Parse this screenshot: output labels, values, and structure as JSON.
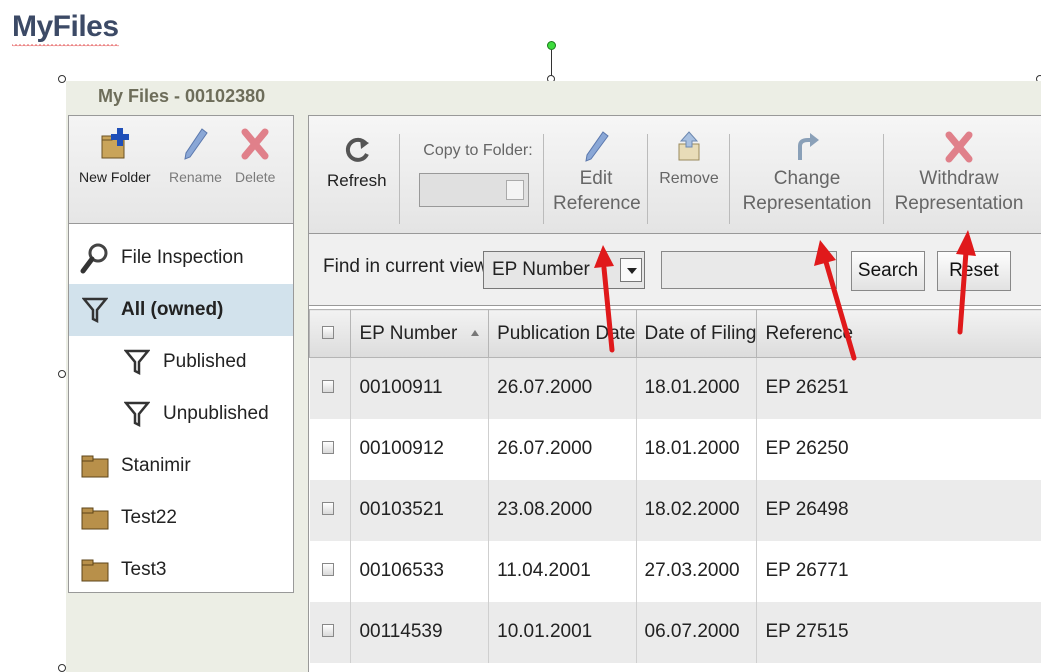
{
  "heading": "MyFiles",
  "window": {
    "title": "My Files - 00102380"
  },
  "left_toolbar": {
    "new_folder": "New Folder",
    "rename": "Rename",
    "delete": "Delete"
  },
  "tree": [
    {
      "label": "File Inspection",
      "icon": "magnifier-icon"
    },
    {
      "label": "All (owned)",
      "icon": "filter-icon",
      "selected": true
    },
    {
      "label": "Published",
      "icon": "filter-icon"
    },
    {
      "label": "Unpublished",
      "icon": "filter-icon"
    },
    {
      "label": "Stanimir",
      "icon": "folder-icon"
    },
    {
      "label": "Test22",
      "icon": "folder-icon"
    },
    {
      "label": "Test3",
      "icon": "folder-icon"
    }
  ],
  "toolbar": {
    "refresh": "Refresh",
    "copy_to_folder": "Copy to Folder:",
    "edit_line1": "Edit",
    "edit_line2": "Reference",
    "remove": "Remove",
    "change_line1": "Change",
    "change_line2": "Representation",
    "withdraw_line1": "Withdraw",
    "withdraw_line2": "Representation"
  },
  "search": {
    "find_label": "Find in current view",
    "field_selected": "EP Number",
    "query": "",
    "search_button": "Search",
    "reset_button": "Reset"
  },
  "table": {
    "columns": [
      "EP Number",
      "Publication Date",
      "Date of Filing",
      "Reference"
    ],
    "rows": [
      {
        "ep": "00100911",
        "pub": "26.07.2000",
        "filing": "18.01.2000",
        "ref": "EP 26251"
      },
      {
        "ep": "00100912",
        "pub": "26.07.2000",
        "filing": "18.01.2000",
        "ref": "EP 26250"
      },
      {
        "ep": "00103521",
        "pub": "23.08.2000",
        "filing": "18.02.2000",
        "ref": "EP 26498"
      },
      {
        "ep": "00106533",
        "pub": "11.04.2001",
        "filing": "27.03.2000",
        "ref": "EP 26771"
      },
      {
        "ep": "00114539",
        "pub": "10.01.2001",
        "filing": "06.07.2000",
        "ref": "EP 27515"
      }
    ]
  },
  "colors": {
    "annotation_arrow": "#e0191b",
    "selected_row": "#d2e2ec",
    "window_bg": "#eceee5"
  }
}
